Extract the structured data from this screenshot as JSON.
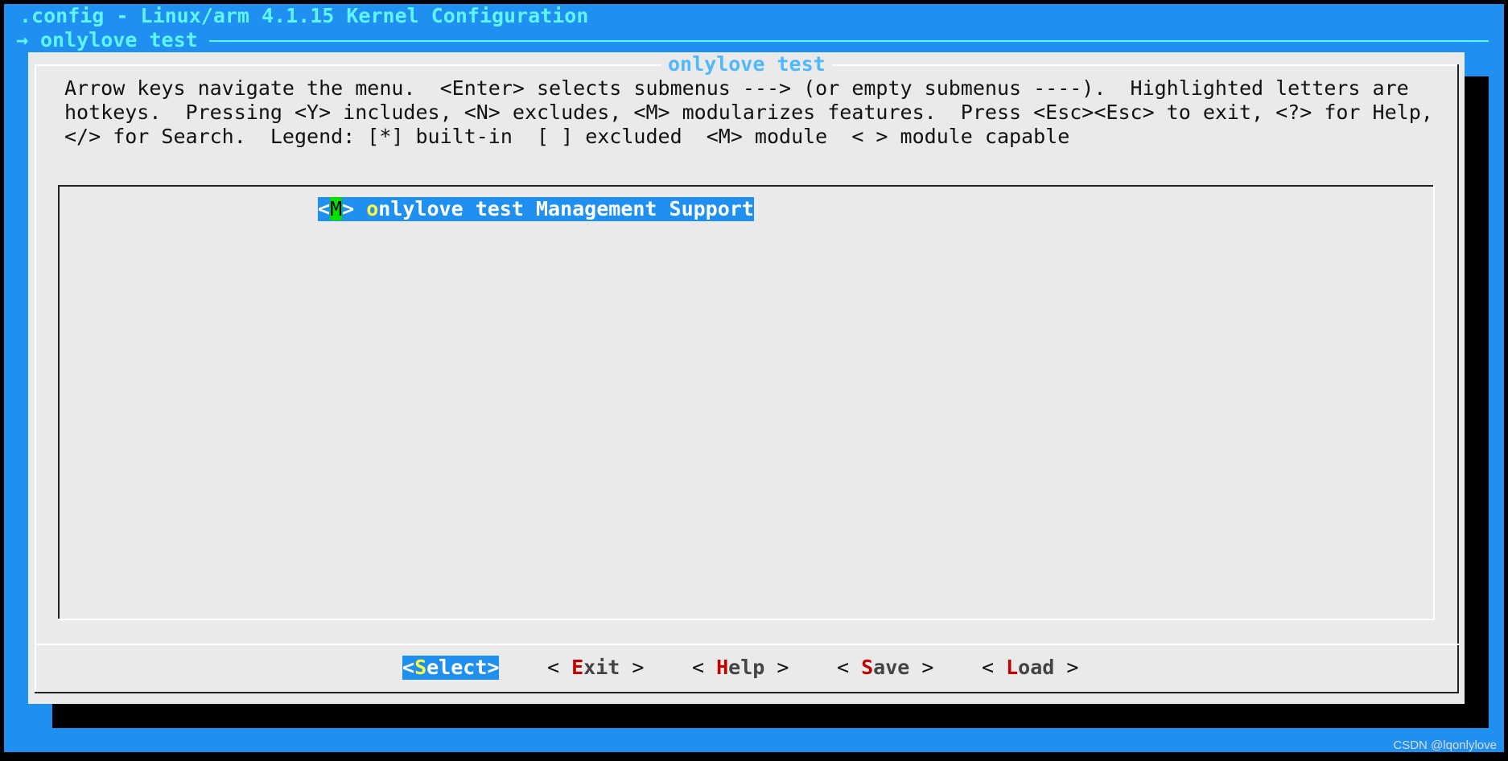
{
  "window": {
    "title": ".config - Linux/arm 4.1.15 Kernel Configuration",
    "breadcrumb_arrow": "→",
    "breadcrumb": "onlylove test"
  },
  "dialog": {
    "title": "onlylove test",
    "help_lines": [
      "Arrow keys navigate the menu.  <Enter> selects submenus ---> (or empty submenus ----).  Highlighted letters are",
      "hotkeys.  Pressing <Y> includes, <N> excludes, <M> modularizes features.  Press <Esc><Esc> to exit, <?> for Help,",
      "</> for Search.  Legend: [*] built-in  [ ] excluded  <M> module  < > module capable"
    ],
    "menu_items": [
      {
        "bracket_open": "<",
        "state": "M",
        "bracket_close": "> ",
        "hotkey": "o",
        "label_rest": "nlylove test Management Support",
        "selected": true
      }
    ]
  },
  "buttons": [
    {
      "open": "<",
      "hotkey": "S",
      "rest": "elect",
      "close": ">",
      "selected": true
    },
    {
      "open": "< ",
      "hotkey": "E",
      "rest": "xit",
      "close": " >"
    },
    {
      "open": "< ",
      "hotkey": "H",
      "rest": "elp",
      "close": " >"
    },
    {
      "open": "< ",
      "hotkey": "S",
      "rest": "ave",
      "close": " >"
    },
    {
      "open": "< ",
      "hotkey": "L",
      "rest": "oad",
      "close": " >"
    }
  ],
  "watermark": "CSDN @lqonlylove",
  "colors": {
    "background": "#2090f0",
    "dialog": "#eaeaea",
    "hotkey": "#c00000",
    "selected_hotkey": "#ffff40",
    "module_state": "#00e000"
  }
}
